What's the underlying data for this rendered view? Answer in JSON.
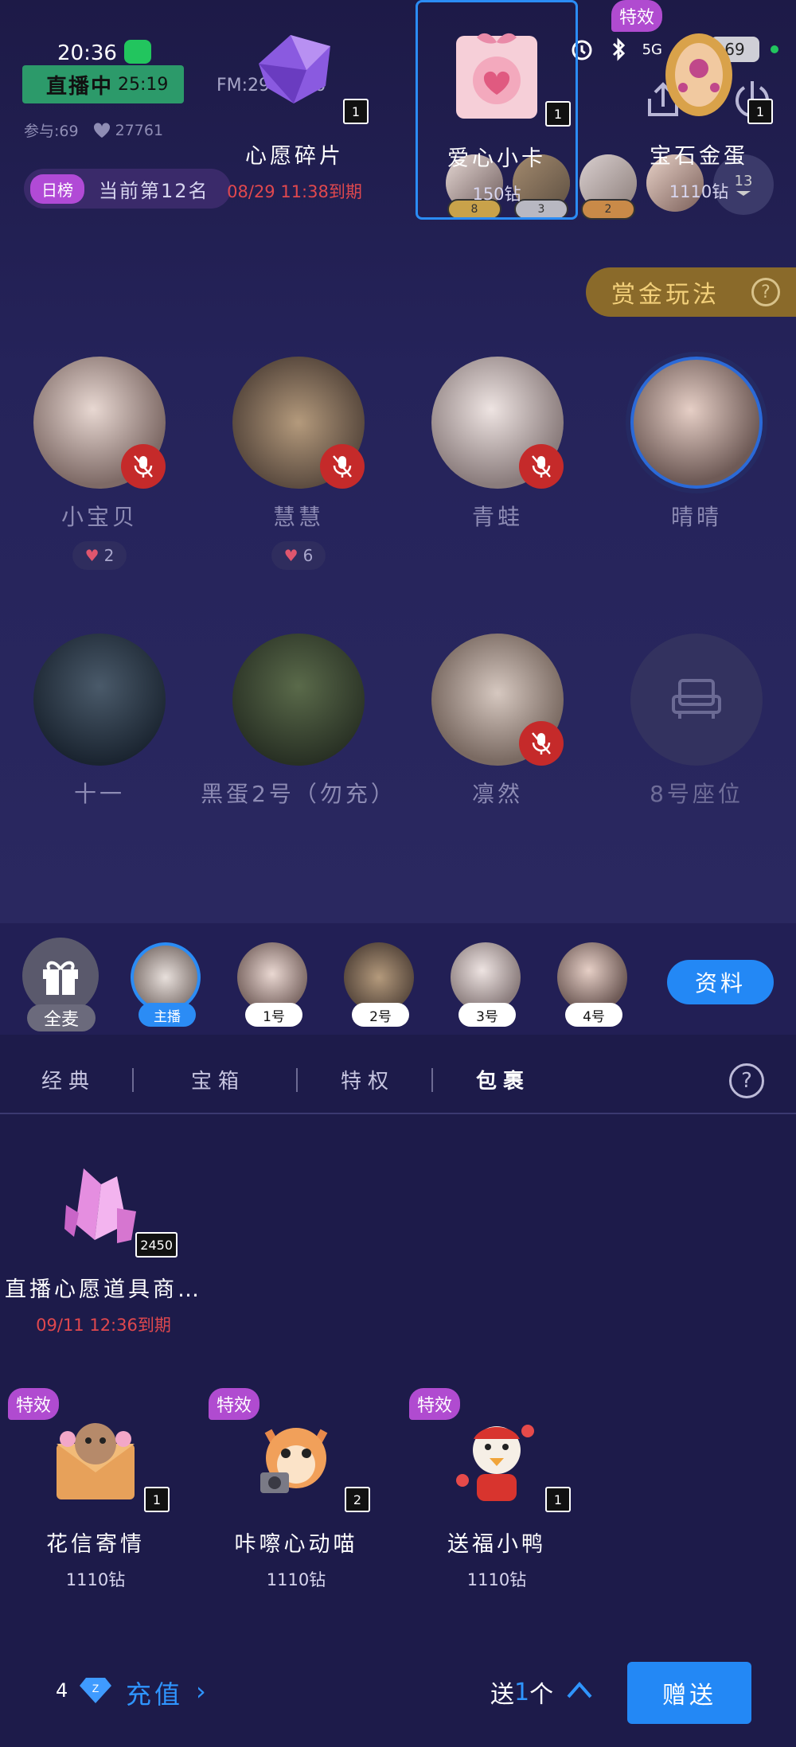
{
  "status_bar": {
    "time": "20:36",
    "network": "5G",
    "battery": "69"
  },
  "room": {
    "live_label": "直播中",
    "live_timer": "25:19",
    "fm_id": "FM:2946066",
    "participants": "参与:69",
    "likes": "27761",
    "rank_tag": "日榜",
    "rank_text": "当前第12名",
    "top_contributors": [
      {
        "rank": "8"
      },
      {
        "rank": "3"
      },
      {
        "rank": "2"
      }
    ],
    "more_count": "13",
    "bounty_label": "赏金玩法",
    "help_glyph": "?",
    "seats": [
      {
        "name": "小宝贝",
        "hearts": "2",
        "muted": true
      },
      {
        "name": "慧慧",
        "hearts": "6",
        "muted": true
      },
      {
        "name": "青蛙",
        "muted": true
      },
      {
        "name": "晴晴",
        "muted": false
      },
      {
        "name": "十一",
        "muted": false
      },
      {
        "name": "黑蛋2号（勿充）",
        "muted": false
      },
      {
        "name": "凛然",
        "muted": true
      },
      {
        "name": "8号座位",
        "muted": false
      }
    ]
  },
  "gift_panel": {
    "all_mic_label": "全麦",
    "recipients": [
      {
        "label": "主播",
        "selected": true
      },
      {
        "label": "1号"
      },
      {
        "label": "2号"
      },
      {
        "label": "3号"
      },
      {
        "label": "4号"
      }
    ],
    "profile_button": "资料",
    "tabs": [
      "经典",
      "宝箱",
      "特权",
      "包裹"
    ],
    "active_tab": "包裹",
    "gifts": [
      {
        "name": "直播心愿道具商…",
        "qty": "2450",
        "sub": "09/11  12:36到期",
        "expiry": true
      },
      {
        "name": "心愿碎片",
        "qty": "1",
        "sub": "08/29  11:38到期",
        "expiry": true
      },
      {
        "name": "爱心小卡",
        "qty": "1",
        "sub": "150钻",
        "selected": true
      },
      {
        "name": "宝石金蛋",
        "qty": "1",
        "sub": "1110钻",
        "tag": "特效"
      },
      {
        "name": "花信寄情",
        "qty": "1",
        "sub": "1110钻",
        "tag": "特效"
      },
      {
        "name": "咔嚓心动喵",
        "qty": "2",
        "sub": "1110钻",
        "tag": "特效"
      },
      {
        "name": "送福小鸭",
        "qty": "1",
        "sub": "1110钻",
        "tag": "特效"
      }
    ],
    "bottom": {
      "diamond_count": "4",
      "recharge_label": "充值",
      "send_prefix": "送",
      "send_count": "1",
      "send_suffix": "个",
      "give_button": "赠送"
    }
  },
  "colors": {
    "accent_blue": "#2388f5",
    "expiry_red": "#e0484e",
    "live_green": "#2c9a6a",
    "effect_purple": "#b04bd0",
    "background": "#1d1b4a"
  }
}
